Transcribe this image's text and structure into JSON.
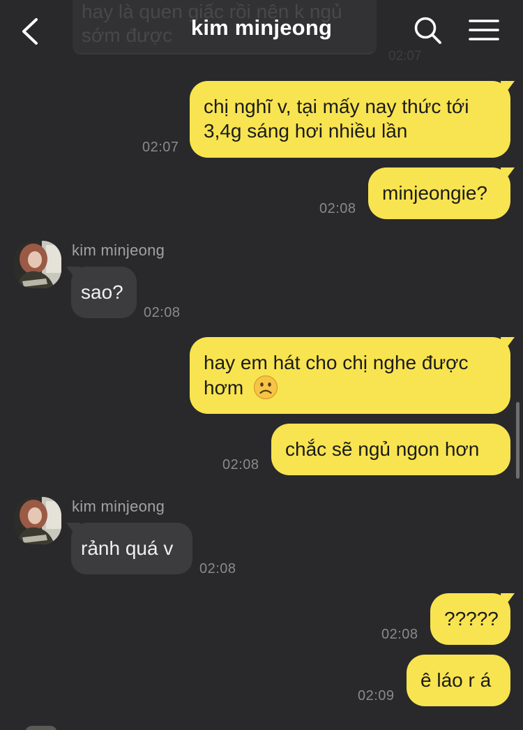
{
  "header": {
    "title": "kim minjeong"
  },
  "previous_message": {
    "lines": [
      "hay là quen giấc rồi nên k ngủ",
      "sớm được"
    ],
    "time": "02:07"
  },
  "messages": [
    {
      "id": "m1",
      "direction": "out",
      "lines": [
        "chị nghĩ v, tại mấy nay thức tới",
        "3,4g sáng hơi nhiều lần"
      ],
      "time": "02:07"
    },
    {
      "id": "m2",
      "direction": "out",
      "lines": [
        "minjeongie?"
      ],
      "time": "02:08"
    },
    {
      "id": "m3",
      "direction": "in",
      "sender": "kim minjeong",
      "lines": [
        "sao?"
      ],
      "time": "02:08"
    },
    {
      "id": "m4",
      "direction": "out",
      "lines": [
        "hay em hát cho chị nghe được",
        "hơm"
      ],
      "emoji": "☹️",
      "time": ""
    },
    {
      "id": "m5",
      "direction": "out",
      "lines": [
        "chắc sẽ ngủ ngon hơn"
      ],
      "time": "02:08"
    },
    {
      "id": "m6",
      "direction": "in",
      "sender": "kim minjeong",
      "lines": [
        "rảnh quá v"
      ],
      "time": "02:08"
    },
    {
      "id": "m7",
      "direction": "out",
      "lines": [
        "?????"
      ],
      "time": "02:08"
    },
    {
      "id": "m8",
      "direction": "out",
      "lines": [
        "ê láo r á"
      ],
      "time": "02:09"
    }
  ],
  "colors": {
    "background": "#29292b",
    "outgoing_bubble": "#f8e450",
    "incoming_bubble": "#3c3c3e",
    "timestamp": "#8a8a8d"
  },
  "icons": {
    "back": "chevron-left-icon",
    "search": "search-icon",
    "menu": "hamburger-menu-icon"
  }
}
